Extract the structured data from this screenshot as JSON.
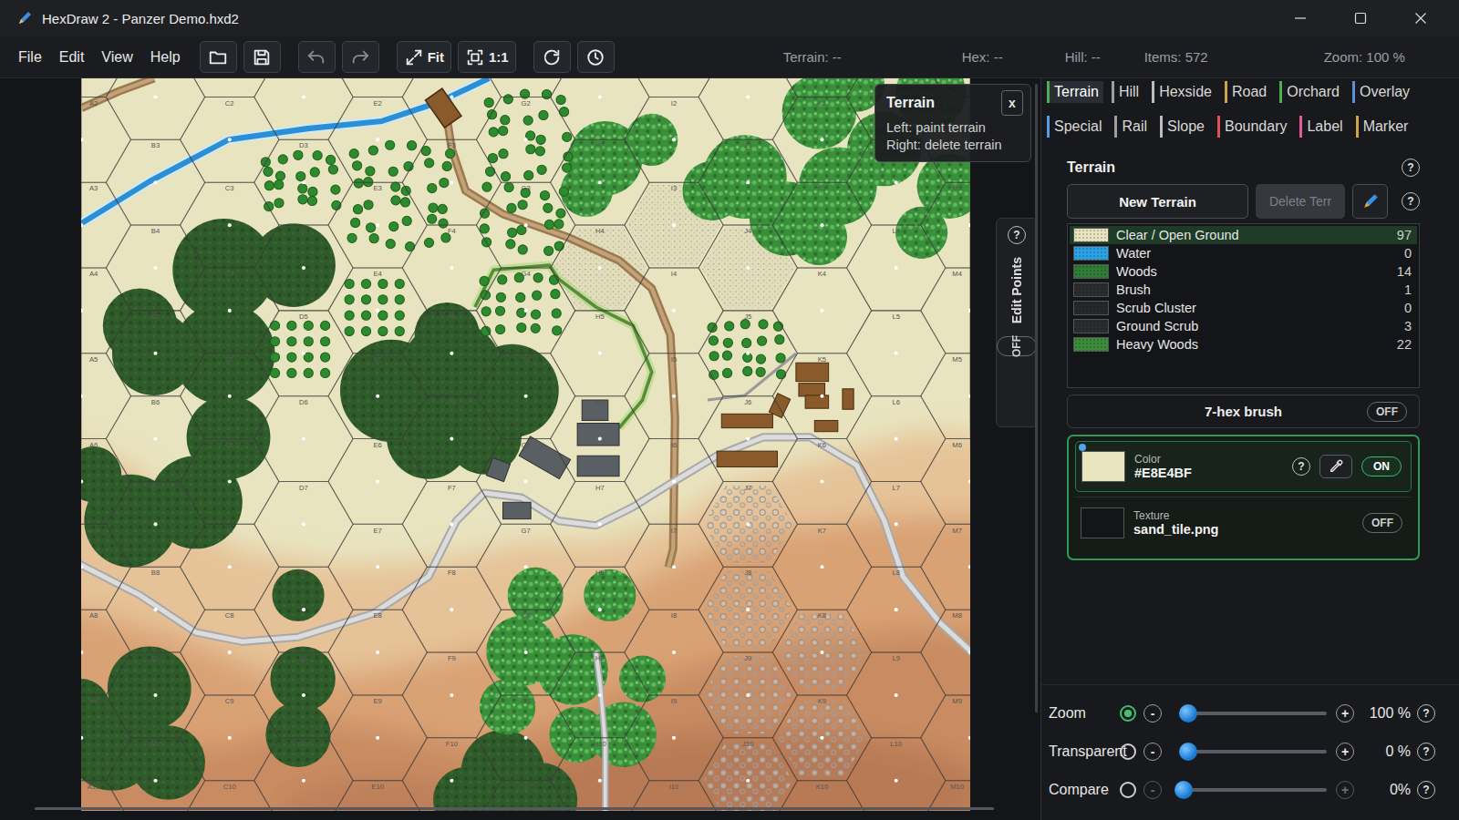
{
  "window": {
    "title": "HexDraw 2 - Panzer Demo.hxd2"
  },
  "menu": [
    "File",
    "Edit",
    "View",
    "Help"
  ],
  "toolbar": [
    {
      "kind": "open",
      "disabled": false
    },
    {
      "kind": "save",
      "disabled": false
    },
    {
      "kind": "undo",
      "disabled": true
    },
    {
      "kind": "redo",
      "disabled": true
    },
    {
      "kind": "fit",
      "label": "Fit",
      "disabled": false
    },
    {
      "kind": "actual",
      "label": "1:1",
      "disabled": false
    },
    {
      "kind": "refresh",
      "disabled": false
    },
    {
      "kind": "history",
      "disabled": false
    }
  ],
  "status": [
    "Terrain: --",
    "Hex: --",
    "Hill: --",
    "Items: 572",
    "Zoom: 100 %"
  ],
  "tooltip": {
    "title": "Terrain",
    "close": "x",
    "lines": [
      "Left: paint terrain",
      "Right: delete terrain"
    ]
  },
  "edit_points": {
    "help": "?",
    "label": "Edit Points",
    "toggle": "OFF",
    "on": false
  },
  "map": {
    "hex_labels": [
      [
        "A2",
        "A3",
        "A4",
        "A5",
        "A6",
        "A7",
        "A8",
        "A9",
        "A10"
      ],
      [
        "B3",
        "B4",
        "B5",
        "B6",
        "B7",
        "B8",
        "B9",
        "B10"
      ],
      [
        "C2",
        "C3",
        "C4",
        "C5",
        "C6",
        "C7",
        "C8",
        "C9",
        "C10"
      ],
      [
        "D3",
        "D4",
        "D5",
        "D6",
        "D7",
        "D8",
        "D9",
        "D10"
      ],
      [
        "E2",
        "E3",
        "E4",
        "E5",
        "E6",
        "E7",
        "E8",
        "E9",
        "E10"
      ],
      [
        "F3",
        "F4",
        "F5",
        "F6",
        "F7",
        "F8",
        "F9",
        "F10"
      ],
      [
        "G2",
        "G3",
        "G4",
        "G5",
        "G6",
        "G7",
        "G8",
        "G9",
        "G10"
      ],
      [
        "H3",
        "H4",
        "H5",
        "H6",
        "H7",
        "H8",
        "H9",
        "H10"
      ],
      [
        "I2",
        "I3",
        "I4",
        "I5",
        "I6",
        "I7",
        "I8",
        "I9",
        "I10"
      ],
      [
        "J3",
        "J4",
        "J5",
        "J6",
        "J7",
        "J8",
        "J9",
        "J10"
      ],
      [
        "K2",
        "K3",
        "K4",
        "K5",
        "K6",
        "K7",
        "K8",
        "K9",
        "K10"
      ],
      [
        "L3",
        "L4",
        "L5",
        "L6",
        "L7",
        "L8",
        "L9",
        "L10"
      ],
      [
        "M2",
        "M3",
        "M4",
        "M5",
        "M6",
        "M7",
        "M8",
        "M9",
        "M10"
      ]
    ]
  },
  "tab_rows": [
    [
      {
        "label": "Terrain",
        "selected": true,
        "color": "#4caf50"
      },
      {
        "label": "Hill",
        "selected": false,
        "color": "#9e9e9e"
      },
      {
        "label": "Hexside",
        "selected": false,
        "color": "#bdbdbd"
      },
      {
        "label": "Road",
        "selected": false,
        "color": "#d4a04a"
      },
      {
        "label": "Orchard",
        "selected": false,
        "color": "#4caf50"
      },
      {
        "label": "Overlay",
        "selected": false,
        "color": "#5c8fd6"
      }
    ],
    [
      {
        "label": "Special",
        "selected": false,
        "color": "#5b9be6"
      },
      {
        "label": "Rail",
        "selected": false,
        "color": "#9e9e9e"
      },
      {
        "label": "Slope",
        "selected": false,
        "color": "#bdbdbd"
      },
      {
        "label": "Boundary",
        "selected": false,
        "color": "#e05252"
      },
      {
        "label": "Label",
        "selected": false,
        "color": "#e05c9c"
      },
      {
        "label": "Marker",
        "selected": false,
        "color": "#d4a04a"
      }
    ]
  ],
  "terrain_panel": {
    "title": "Terrain",
    "help": "?",
    "new_button": "New Terrain",
    "delete_button": {
      "label": "Delete Terr",
      "disabled": true
    },
    "edit_help": "?",
    "items": [
      {
        "name": "Clear / Open Ground",
        "count": "97",
        "color": "#E8E4BF",
        "selected": true
      },
      {
        "name": "Water",
        "count": "0",
        "color": "#2aa3e6",
        "selected": false
      },
      {
        "name": "Woods",
        "count": "14",
        "color": "#2f7d36",
        "selected": false
      },
      {
        "name": "Brush",
        "count": "1",
        "color": "#2a2c2e",
        "selected": false
      },
      {
        "name": "Scrub Cluster",
        "count": "0",
        "color": "#26282a",
        "selected": false
      },
      {
        "name": "Ground Scrub",
        "count": "3",
        "color": "#2a2c2e",
        "selected": false
      },
      {
        "name": "Heavy Woods",
        "count": "22",
        "color": "#3b8c3b",
        "selected": false
      }
    ],
    "brush": {
      "label": "7-hex brush",
      "toggle": "OFF",
      "on": false
    },
    "color": {
      "label": "Color",
      "value": "#E8E4BF",
      "help": "?",
      "toggle": "ON",
      "on": true
    },
    "texture": {
      "label": "Texture",
      "value": "sand_tile.png",
      "toggle": "OFF",
      "on": false
    }
  },
  "sliders": [
    {
      "label": "Zoom",
      "selected": true,
      "level": 0.03,
      "reading": "100 %",
      "minus": "-",
      "plus": "+",
      "help": "?",
      "disabled": false
    },
    {
      "label": "Transparent",
      "selected": false,
      "level": 0.03,
      "reading": "0 %",
      "minus": "-",
      "plus": "+",
      "help": "?",
      "disabled": false
    },
    {
      "label": "Compare",
      "selected": false,
      "level": 0.0,
      "reading": "0%",
      "minus": "-",
      "plus": "+",
      "help": "?",
      "disabled": true
    }
  ]
}
